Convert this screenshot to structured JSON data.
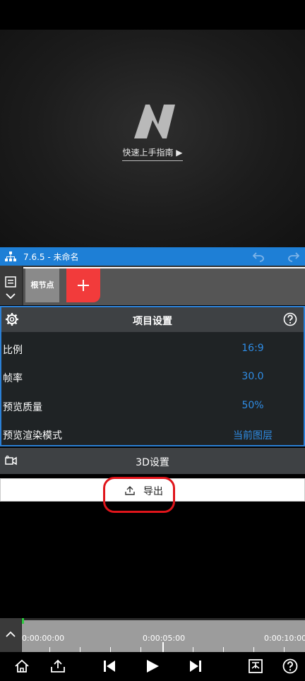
{
  "preview": {
    "guide_label": "快速上手指南 ▶"
  },
  "titlebar": {
    "title": "7.6.5 - 未命名"
  },
  "nodes": {
    "root_label": "根节点"
  },
  "project_settings": {
    "title": "项目设置",
    "rows": [
      {
        "key": "比例",
        "value": "16:9"
      },
      {
        "key": "帧率",
        "value": "30.0"
      },
      {
        "key": "预览质量",
        "value": "50%"
      },
      {
        "key": "预览渲染模式",
        "value": "当前图层"
      }
    ]
  },
  "threed": {
    "label": "3D设置"
  },
  "export": {
    "label": "导出"
  },
  "timeline": {
    "labels": [
      "0:00:00:00",
      "0:00:05:00",
      "0:00:10:00"
    ],
    "playhead_color": "#2ecc40"
  },
  "colors": {
    "accent": "#1e7fd6",
    "value_blue": "#2f8de6",
    "add_red": "#f23b3b",
    "annotation_red": "#e0151b"
  },
  "icons": [
    "tree-icon",
    "undo-icon",
    "redo-icon",
    "layers-icon",
    "chevron-down-icon",
    "plus-icon",
    "gear-icon",
    "help-icon",
    "camera-icon",
    "export-icon",
    "chevron-up-icon",
    "home-icon",
    "share-icon",
    "skip-back-icon",
    "play-icon",
    "skip-forward-icon",
    "bookmark-icon"
  ]
}
